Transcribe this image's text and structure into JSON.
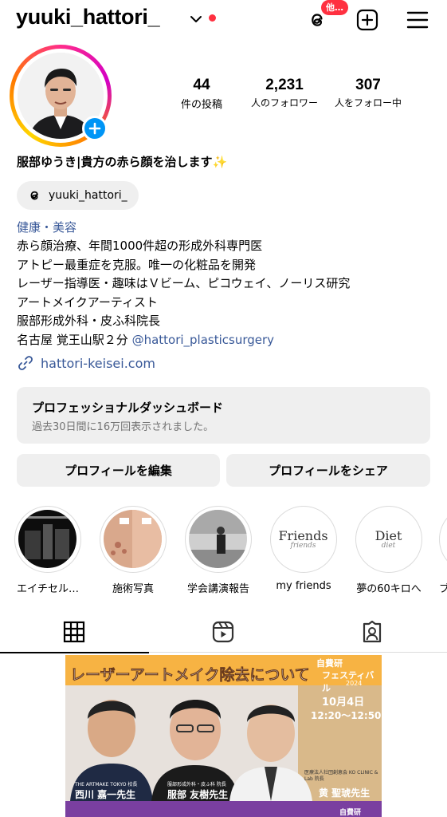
{
  "header": {
    "username": "yuuki_hattori_",
    "threads_badge": "他…",
    "icons": [
      "chevron-down-icon",
      "threads-icon",
      "create-plus-icon",
      "menu-icon"
    ]
  },
  "profile": {
    "stats": [
      {
        "value": "44",
        "label": "件の投稿"
      },
      {
        "value": "2,231",
        "label": "人のフォロワー"
      },
      {
        "value": "307",
        "label": "人をフォロー中"
      }
    ],
    "full_name": "服部ゆうき|貴方の赤ら顔を治します✨",
    "threads_handle": "yuuki_hattori_",
    "category": "健康・美容",
    "bio_lines": [
      "赤ら顔治療、年間1000件超の形成外科専門医",
      "アトピー最重症を克服。唯一の化粧品を開発",
      "レーザー指導医・趣味はＶビーム、ピコウェイ、ノーリス研究",
      "アートメイクアーティスト",
      "服部形成外科・皮ふ科院長"
    ],
    "bio_last_line_text": "名古屋 覚王山駅２分",
    "bio_mention": "@hattori_plasticsurgery",
    "link": "hattori-keisei.com"
  },
  "dashboard": {
    "title": "プロフェッショナルダッシュボード",
    "subtitle": "過去30日間に16万回表示されました。"
  },
  "buttons": {
    "edit": "プロフィールを編集",
    "share": "プロフィールをシェア"
  },
  "highlights": [
    {
      "label": "エイチセル…"
    },
    {
      "label": "施術写真"
    },
    {
      "label": "学会講演報告"
    },
    {
      "label": "my friends",
      "cover_text": "Friends",
      "cover_script": "friends"
    },
    {
      "label": "夢の60キロへ",
      "cover_text": "Diet",
      "cover_script": "diet"
    },
    {
      "label": "ブ"
    }
  ],
  "tabs": [
    {
      "name": "grid",
      "icon": "grid-icon",
      "active": true
    },
    {
      "name": "reels",
      "icon": "reels-icon",
      "active": false
    },
    {
      "name": "tagged",
      "icon": "tagged-icon",
      "active": false
    }
  ],
  "post": {
    "title": "レーザーアートメイク除去について",
    "event_name_1": "自費研",
    "event_name_2": "フェスティバル",
    "event_year": "2024",
    "date": "10月4日",
    "time": "12:20〜12:50",
    "speakers": [
      {
        "affiliation": "THE ARTMAKE TOKYO 校長",
        "name": "西川 嘉一先生"
      },
      {
        "affiliation": "服部形成外科・皮ふ科 院長",
        "name": "服部 友樹先生"
      },
      {
        "affiliation": "医療法人社団創恵会 KO CLINIC & Lab 院長",
        "name": "黄 聖琥先生"
      }
    ],
    "next_strip": "自費研"
  },
  "colors": {
    "link_blue": "#385898",
    "notification_red": "#ff3040",
    "follow_blue": "#0095f6",
    "button_grey": "#efefef",
    "post_orange": "#f7b343",
    "post_purple": "#7a3fa0"
  }
}
